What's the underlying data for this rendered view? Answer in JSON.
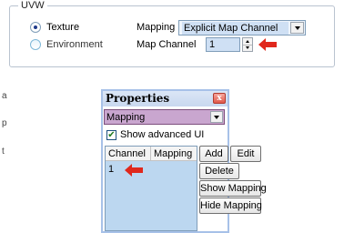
{
  "uvw": {
    "title": "UVW",
    "texture_label": "Texture",
    "texture_checked": true,
    "environment_label": "Environment",
    "environment_checked": false,
    "mapping_label": "Mapping",
    "mapping_value": "Explicit Map Channel",
    "map_channel_label": "Map Channel",
    "map_channel_value": "1"
  },
  "side_letters": [
    "a",
    "p",
    "t"
  ],
  "properties": {
    "title": "Properties",
    "close_label": "x",
    "mapping_dropdown_value": "Mapping",
    "show_advanced_label": "Show advanced UI",
    "show_advanced_checked": true,
    "table": {
      "columns": [
        "Channel",
        "Mapping"
      ],
      "rows": [
        [
          "1",
          ""
        ]
      ]
    },
    "buttons": {
      "add": "Add",
      "edit": "Edit",
      "delete": "Delete",
      "show_mapping": "Show Mapping",
      "hide_mapping": "Hide Mapping"
    }
  },
  "colors": {
    "annotation_arrow": "#e0281c",
    "selected_field": "#cfe0f4",
    "dropdown_highlight": "#c9a6cf",
    "table_background": "#bcd7f0"
  }
}
